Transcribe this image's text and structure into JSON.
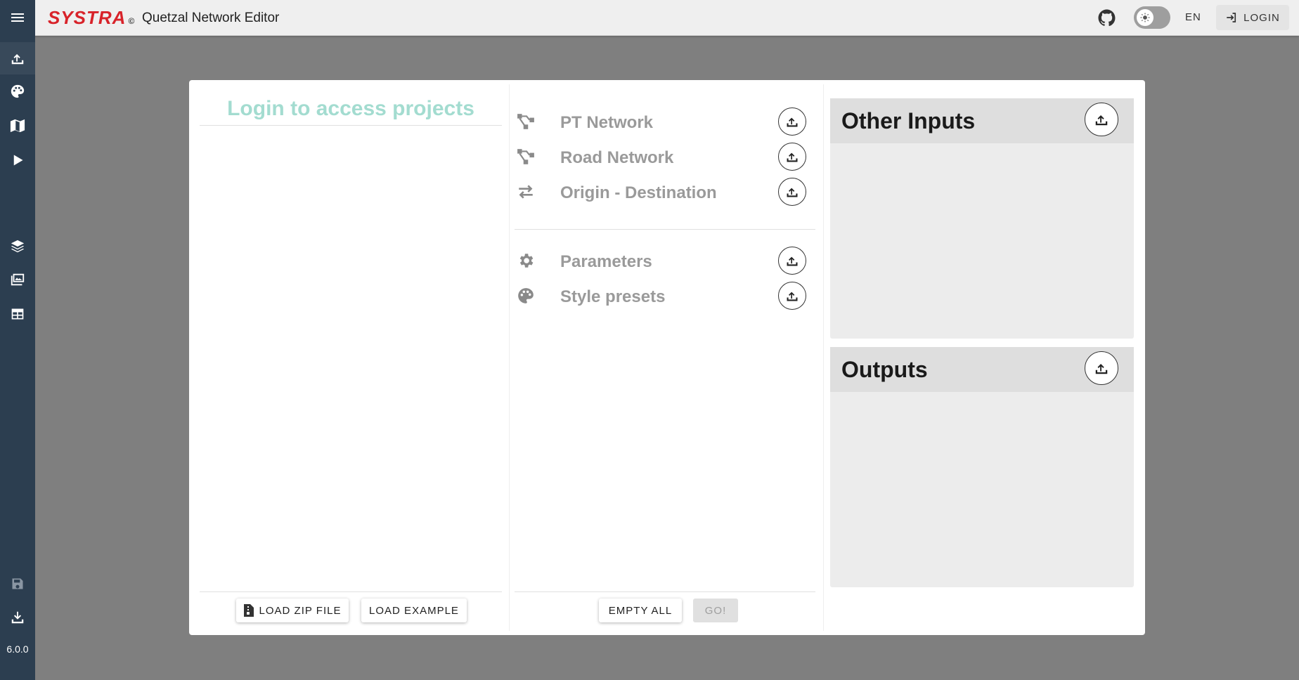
{
  "header": {
    "logo": "SYSTRA",
    "logo_mark": "©",
    "title": "Quetzal Network Editor",
    "lang": "EN",
    "login_label": "LOGIN"
  },
  "sidebar": {
    "items": [
      {
        "icon": "upload-icon"
      },
      {
        "icon": "palette-icon"
      },
      {
        "icon": "map-icon"
      },
      {
        "icon": "play-icon"
      },
      {
        "icon": "layers-icon"
      },
      {
        "icon": "images-icon"
      },
      {
        "icon": "table-icon"
      },
      {
        "icon": "save-icon"
      },
      {
        "icon": "download-icon"
      }
    ],
    "version": "6.0.0"
  },
  "projects": {
    "heading": "Login to access projects",
    "load_zip_label": "LOAD ZIP FILE",
    "load_example_label": "LOAD EXAMPLE"
  },
  "inputs": {
    "files": [
      {
        "label": "PT Network",
        "icon": "network-icon"
      },
      {
        "label": "Road Network",
        "icon": "network-icon"
      },
      {
        "label": "Origin - Destination",
        "icon": "swap-arrows-icon"
      }
    ],
    "config": [
      {
        "label": "Parameters",
        "icon": "gear-icon"
      },
      {
        "label": "Style presets",
        "icon": "palette-icon"
      }
    ],
    "empty_all_label": "EMPTY ALL",
    "go_label": "GO!"
  },
  "panels": {
    "other_inputs_title": "Other Inputs",
    "outputs_title": "Outputs"
  },
  "colors": {
    "sidebar": "#2c3e50",
    "brand": "#d8232a",
    "heading_teal": "#a3dcd0",
    "backdrop": "#7f7f7f"
  }
}
